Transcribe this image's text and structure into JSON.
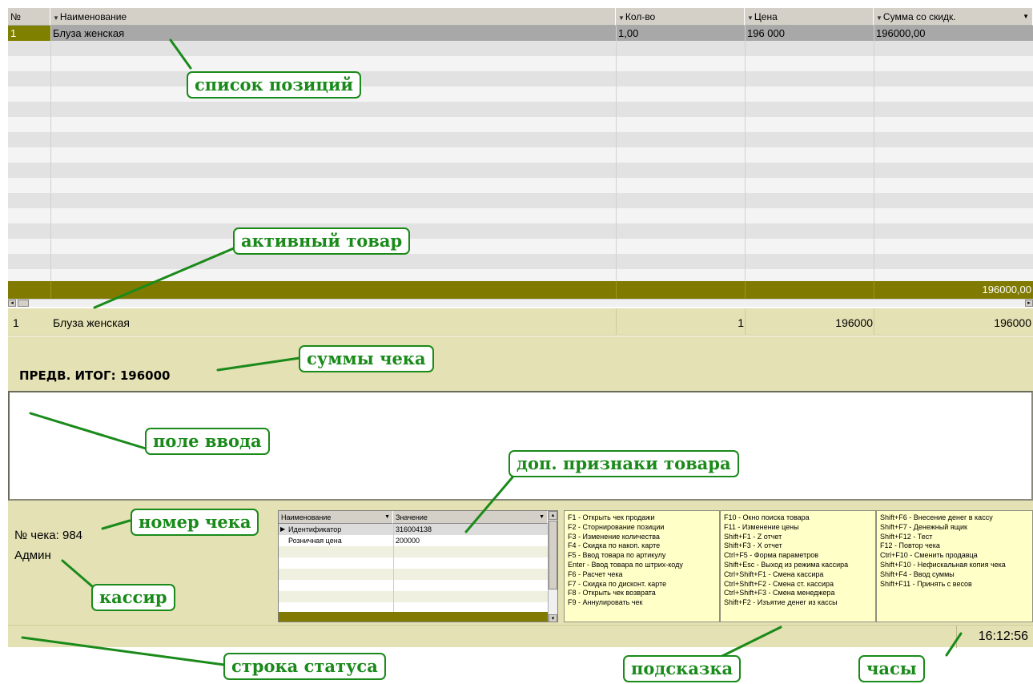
{
  "grid": {
    "columns": [
      "№",
      "Наименование",
      "Кол-во",
      "Цена",
      "Сумма со скидк."
    ],
    "rows": [
      {
        "num": "1",
        "name": "Блуза женская",
        "qty": "1,00",
        "price": "196 000",
        "sum": "196000,00"
      }
    ],
    "footer_sum": "196000,00"
  },
  "active_item": {
    "num": "1",
    "name": "Блуза женская",
    "qty": "1",
    "price": "196000",
    "sum": "196000"
  },
  "subtotal": "ПРЕДВ. ИТОГ: 196000",
  "check_number": "№ чека: 984",
  "cashier": "Админ",
  "attributes": {
    "headers": [
      "Наименование",
      "Значение"
    ],
    "rows": [
      {
        "name": "Идентификатор",
        "value": "316004138"
      },
      {
        "name": "Розничная цена",
        "value": "200000"
      }
    ]
  },
  "hints": {
    "col1": [
      "F1 - Открыть чек продажи",
      "F2 - Сторнирование позиции",
      "F3 - Изменение количества",
      "F4 - Скидка по накоп. карте",
      "F5 - Ввод товара по артикулу",
      "Enter - Ввод товара по штрих-коду",
      "F6 - Расчет чека",
      "F7 - Скидка по дисконт. карте",
      "F8 - Открыть чек возврата",
      "F9 - Аннулировать чек"
    ],
    "col2": [
      "F10 - Окно поиска товара",
      "F11 - Изменение цены",
      "Shift+F1 - Z отчет",
      "Shift+F3 - X отчет",
      "Ctrl+F5 - Форма параметров",
      "Shift+Esc - Выход из режима кассира",
      "Ctrl+Shift+F1 - Смена кассира",
      "Ctrl+Shift+F2 - Смена ст. кассира",
      "Ctrl+Shift+F3 - Смена менеджера",
      "Shift+F2 - Изъятие денег из кассы"
    ],
    "col3": [
      "Shift+F6 - Внесение денег в кассу",
      "Shift+F7 - Денежный ящик",
      "Shift+F12 - Тест",
      "F12 - Повтор чека",
      "Ctrl+F10 - Сменить продавца",
      "Shift+F10 - Нефискальная копия чека",
      "Shift+F4 - Ввод суммы",
      "Shift+F11 - Принять с весов"
    ]
  },
  "clock": "16:12:56",
  "callouts": {
    "items_list": "список позиций",
    "active_item": "активный товар",
    "check_sums": "суммы чека",
    "input_field": "поле ввода",
    "item_attributes": "доп. признаки товара",
    "check_number": "номер чека",
    "cashier": "кассир",
    "status_bar": "строка статуса",
    "hint": "подсказка",
    "clock": "часы"
  }
}
